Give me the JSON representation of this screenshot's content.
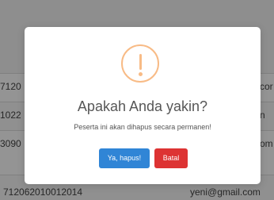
{
  "table": {
    "rows": [
      {
        "left": "7120",
        "right": "cor"
      },
      {
        "left": "1022",
        "right": "n"
      },
      {
        "left": "3090",
        "right": "om"
      },
      {
        "left": "712062010012014",
        "right": "yeni@gmail.com"
      }
    ]
  },
  "dialog": {
    "icon": "exclamation-icon",
    "title": "Apakah Anda yakin?",
    "message": "Peserta ini akan dihapus secara permanen!",
    "confirm_label": "Ya, hapus!",
    "cancel_label": "Batal",
    "colors": {
      "icon": "#f8bb86",
      "confirm": "#3085d6",
      "cancel": "#dd3333"
    }
  }
}
